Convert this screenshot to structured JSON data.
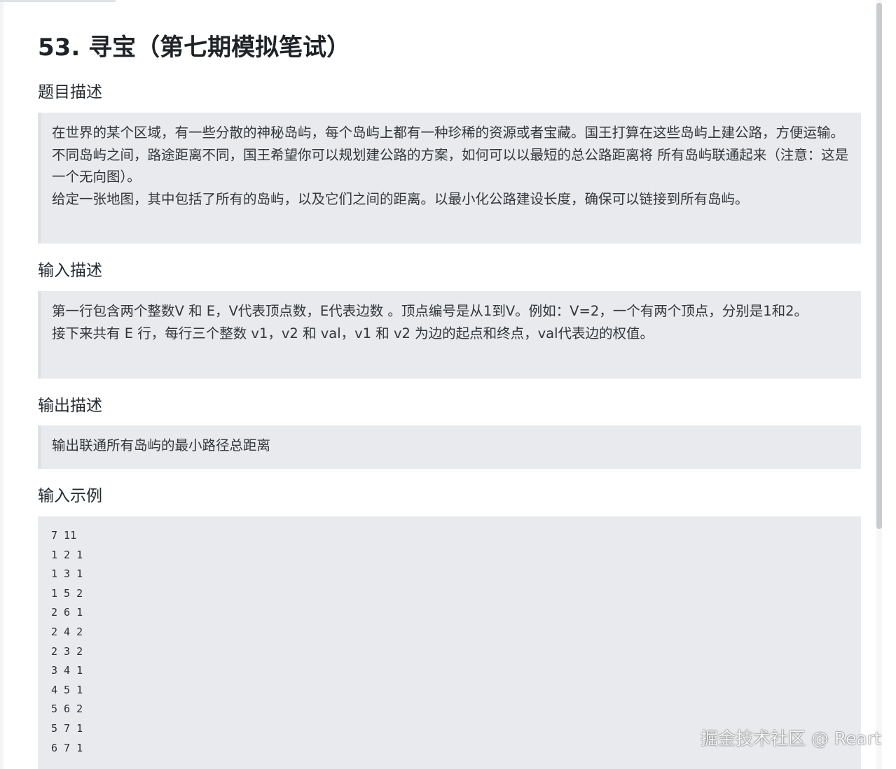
{
  "title": "53. 寻宝（第七期模拟笔试）",
  "sections": {
    "problem": {
      "heading": "题目描述",
      "paragraphs": [
        "在世界的某个区域，有一些分散的神秘岛屿，每个岛屿上都有一种珍稀的资源或者宝藏。国王打算在这些岛屿上建公路，方便运输。",
        "不同岛屿之间，路途距离不同，国王希望你可以规划建公路的方案，如何可以以最短的总公路距离将 所有岛屿联通起来（注意：这是一个无向图）。",
        "给定一张地图，其中包括了所有的岛屿，以及它们之间的距离。以最小化公路建设长度，确保可以链接到所有岛屿。"
      ]
    },
    "input": {
      "heading": "输入描述",
      "paragraphs": [
        "第一行包含两个整数V 和 E，V代表顶点数，E代表边数 。顶点编号是从1到V。例如：V=2，一个有两个顶点，分别是1和2。",
        "接下来共有 E 行，每行三个整数 v1，v2 和 val，v1 和 v2 为边的起点和终点，val代表边的权值。"
      ]
    },
    "output": {
      "heading": "输出描述",
      "paragraphs": [
        "输出联通所有岛屿的最小路径总距离"
      ]
    },
    "example": {
      "heading": "输入示例",
      "lines": [
        "7 11",
        "1 2 1",
        "1 3 1",
        "1 5 2",
        "2 6 1",
        "2 4 2",
        "2 3 2",
        "3 4 1",
        "4 5 1",
        "5 6 2",
        "5 7 1",
        "6 7 1"
      ]
    }
  },
  "watermark": "掘金技术社区 @ Reart"
}
